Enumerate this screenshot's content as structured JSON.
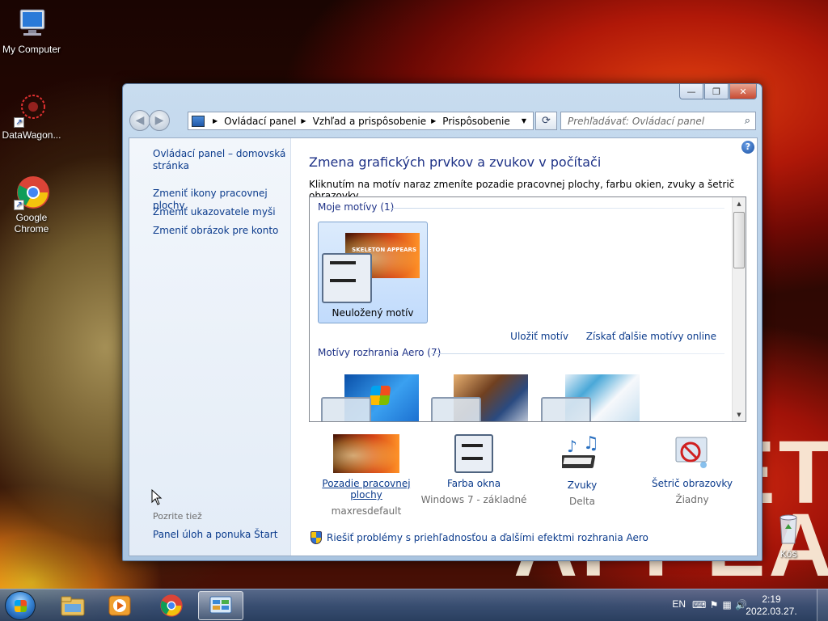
{
  "desktop": {
    "icons": [
      {
        "label": "My Computer"
      },
      {
        "label": "DataWagon..."
      },
      {
        "label": "Google Chrome"
      },
      {
        "label": "Kôš"
      }
    ],
    "wallpaper_text": "ET\nAPPEA"
  },
  "window": {
    "controls": {
      "minimize": "—",
      "maximize": "❐",
      "close": "✕"
    },
    "address": {
      "crumbs": [
        "Ovládací panel",
        "Vzhľad a prispôsobenie",
        "Prispôsobenie"
      ],
      "dropdown": "▼",
      "refresh": "⟳"
    },
    "search": {
      "placeholder": "Prehľadávať: Ovládací panel"
    },
    "sidebar": {
      "home_link": "Ovládací panel – domovská stránka",
      "links": [
        "Zmeniť ikony pracovnej plochy",
        "Zmeniť ukazovatele myši",
        "Zmeniť obrázok pre konto"
      ],
      "see_also_heading": "Pozrite tiež",
      "see_also_links": [
        "Panel úloh a ponuka Štart"
      ]
    },
    "main": {
      "title": "Zmena grafických prvkov a zvukov v počítači",
      "description": "Kliknutím na motív naraz zmeníte pozadie pracovnej plochy, farbu okien, zvuky a šetrič obrazovky.",
      "my_themes_heading": "Moje motívy (1)",
      "selected_theme": "Neuložený motív",
      "thumb_text": "SKELETON APPEARS",
      "save_theme": "Uložiť motív",
      "get_more_online": "Získať ďalšie motívy online",
      "aero_heading": "Motívy rozhrania Aero (7)",
      "bottom_items": [
        {
          "label": "Pozadie pracovnej plochy",
          "sub": "maxresdefault"
        },
        {
          "label": "Farba okna",
          "sub": "Windows 7 - základné"
        },
        {
          "label": "Zvuky",
          "sub": "Delta"
        },
        {
          "label": "Šetrič obrazovky",
          "sub": "Žiadny"
        }
      ],
      "aero_fix_link": "Riešiť problémy s priehľadnosťou a ďalšími efektmi rozhrania Aero"
    }
  },
  "taskbar": {
    "language": "EN",
    "time": "2:19",
    "date": "2022.03.27."
  },
  "colors": {
    "link": "#0b3b8c",
    "heading": "#1e3287",
    "taskbar": "#3a5a84"
  }
}
